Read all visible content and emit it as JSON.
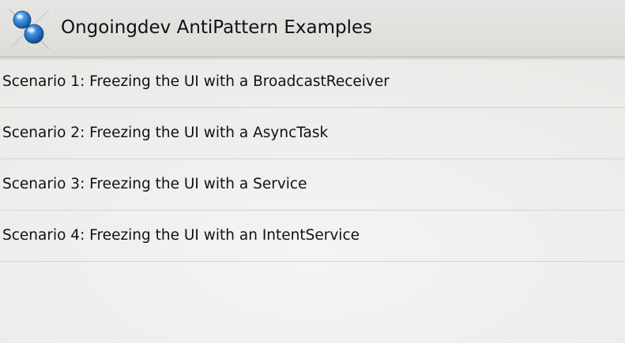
{
  "action_bar": {
    "icon": "app-pushpin-icon",
    "title": "Ongoingdev AntiPattern Examples"
  },
  "scenarios": [
    {
      "label": "Scenario 1: Freezing the UI with a BroadcastReceiver"
    },
    {
      "label": "Scenario 2: Freezing the UI with a AsyncTask"
    },
    {
      "label": "Scenario 3: Freezing the UI with a Service"
    },
    {
      "label": "Scenario 4: Freezing the UI with an IntentService"
    }
  ],
  "colors": {
    "action_bar_background": "#dfdfdc",
    "screen_background": "#ececea",
    "divider": "#d3d3d0",
    "text": "#111111",
    "icon_blue": "#2a7fd0"
  }
}
